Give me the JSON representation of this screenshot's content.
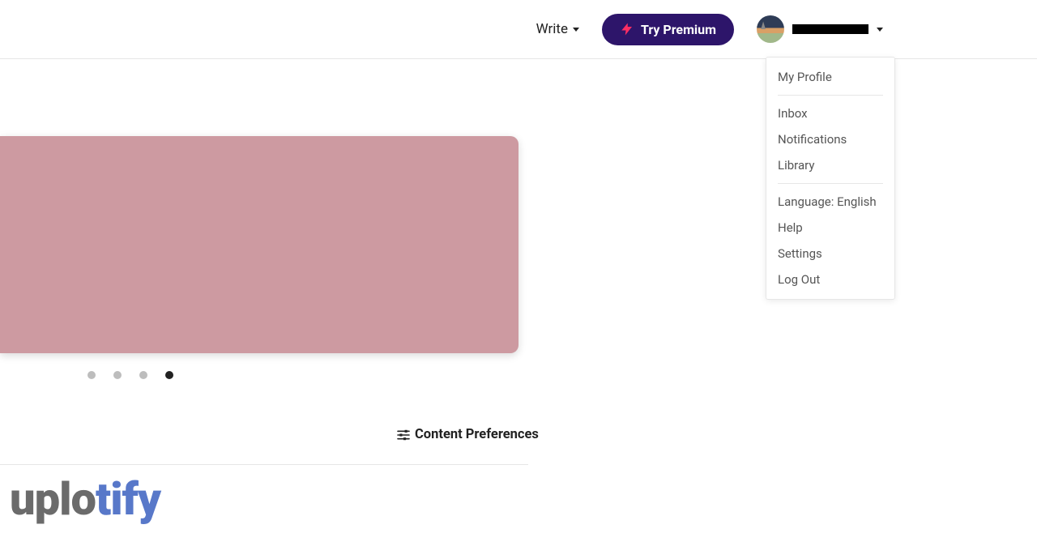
{
  "header": {
    "write_label": "Write",
    "premium_label": "Try Premium"
  },
  "user_menu": {
    "items": [
      "My Profile",
      "Inbox",
      "Notifications",
      "Library",
      "Language: English",
      "Help",
      "Settings",
      "Log Out"
    ]
  },
  "hero": {
    "carousel": {
      "count": 4,
      "active_index": 3
    }
  },
  "content_prefs_label": "Content Preferences",
  "brand": {
    "part1": "uplo",
    "part2": "tify"
  }
}
